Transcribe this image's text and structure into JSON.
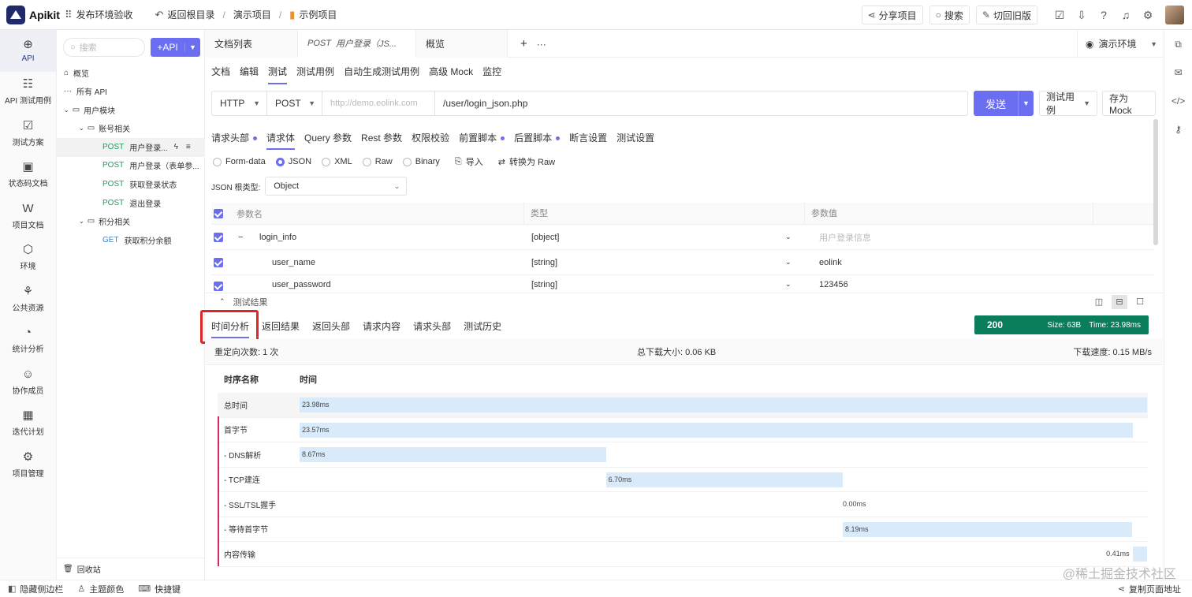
{
  "app": {
    "name": "Apikit",
    "env_check": "发布环境验收",
    "back_root": "返回根目录",
    "crumb_sep": "/",
    "crumb_demo": "演示项目",
    "crumb_sample": "示例项目"
  },
  "top_actions": {
    "share": "分享项目",
    "search": "搜索",
    "old_version": "切回旧版"
  },
  "left_nav": [
    {
      "label": "API",
      "icon": "api-icon"
    },
    {
      "label": "API 测试用例",
      "icon": "test-case-icon"
    },
    {
      "label": "测试方案",
      "icon": "test-plan-icon"
    },
    {
      "label": "状态码文档",
      "icon": "status-code-icon"
    },
    {
      "label": "项目文档",
      "icon": "doc-icon"
    },
    {
      "label": "环境",
      "icon": "env-icon"
    },
    {
      "label": "公共资源",
      "icon": "resource-icon"
    },
    {
      "label": "统计分析",
      "icon": "stats-icon"
    },
    {
      "label": "协作成员",
      "icon": "members-icon"
    },
    {
      "label": "迭代计划",
      "icon": "iteration-icon"
    },
    {
      "label": "项目管理",
      "icon": "settings-icon"
    }
  ],
  "tree": {
    "search_placeholder": "搜索",
    "add_api": "+API",
    "items": [
      {
        "label": "概览"
      },
      {
        "label": "所有 API"
      },
      {
        "label": "用户模块"
      },
      {
        "label": "账号相关"
      },
      {
        "method": "POST",
        "label": "用户登录..."
      },
      {
        "method": "POST",
        "label": "用户登录（表单参..."
      },
      {
        "method": "POST",
        "label": "获取登录状态"
      },
      {
        "method": "POST",
        "label": "退出登录"
      },
      {
        "label": "积分相关"
      },
      {
        "method": "GET",
        "label": "获取积分余额"
      }
    ],
    "recycle": "回收站"
  },
  "doc_tabs": {
    "list": "文档列表",
    "active_method": "POST",
    "active_label": "用户登录（JS...",
    "overview": "概览",
    "plus": "+",
    "more": "···"
  },
  "env": {
    "label": "演示环境"
  },
  "subnav": [
    "文档",
    "编辑",
    "测试",
    "测试用例",
    "自动生成测试用例",
    "高级 Mock",
    "监控"
  ],
  "request": {
    "protocol": "HTTP",
    "method": "POST",
    "host_placeholder": "http://demo.eolink.com",
    "path": "/user/login_json.php",
    "send": "发送",
    "test_case": "测试用例",
    "save_mock": "存为 Mock"
  },
  "req_tabs": [
    {
      "label": "请求头部",
      "dot": true
    },
    {
      "label": "请求体",
      "dot": false
    },
    {
      "label": "Query 参数",
      "dot": false
    },
    {
      "label": "Rest 参数",
      "dot": false
    },
    {
      "label": "权限校验",
      "dot": false
    },
    {
      "label": "前置脚本",
      "dot": true
    },
    {
      "label": "后置脚本",
      "dot": true
    },
    {
      "label": "断言设置",
      "dot": false
    },
    {
      "label": "测试设置",
      "dot": false
    }
  ],
  "body_types": {
    "form": "Form-data",
    "json": "JSON",
    "xml": "XML",
    "raw": "Raw",
    "binary": "Binary",
    "import": "导入",
    "to_raw": "转换为 Raw"
  },
  "json_root": {
    "label": "JSON 根类型:",
    "value": "Object"
  },
  "params": {
    "headers": {
      "name": "参数名",
      "type": "类型",
      "value": "参数值"
    },
    "rows": [
      {
        "name": "login_info",
        "type": "[object]",
        "value": "用户登录信息"
      },
      {
        "name": "user_name",
        "type": "[string]",
        "value": "eolink"
      },
      {
        "name": "user_password",
        "type": "[string]",
        "value": "123456"
      }
    ]
  },
  "results": {
    "title": "测试结果",
    "tabs": [
      "时间分析",
      "返回结果",
      "返回头部",
      "请求内容",
      "请求头部",
      "测试历史"
    ],
    "status": {
      "code": "200",
      "size": "Size: 63B",
      "time": "Time: 23.98ms"
    },
    "redirects": "重定向次数: 1 次",
    "download_size": "总下载大小: 0.06 KB",
    "download_speed": "下载速度: 0.15 MB/s",
    "timing_headers": {
      "name": "时序名称",
      "time": "时间"
    },
    "timings": [
      {
        "name": "总时间",
        "ms": "23.98ms"
      },
      {
        "name": "首字节",
        "ms": "23.57ms"
      },
      {
        "name": "- DNS解析",
        "ms": "8.67ms"
      },
      {
        "name": "- TCP建连",
        "ms": "6.70ms"
      },
      {
        "name": "- SSL/TSL握手",
        "ms": "0.00ms"
      },
      {
        "name": "- 等待首字节",
        "ms": "8.19ms"
      },
      {
        "name": "内容传输",
        "ms": "0.41ms"
      }
    ]
  },
  "statusbar": {
    "hide_sidebar": "隐藏侧边栏",
    "theme": "主题颜色",
    "shortcuts": "快捷键",
    "copy_url": "复制页面地址"
  },
  "watermark": "@稀土掘金技术社区",
  "colors": {
    "accent": "#6b6ef0",
    "status_ok": "#0a7d5a",
    "highlight": "#e02424",
    "post": "#19a05b",
    "get": "#3b83d6"
  }
}
